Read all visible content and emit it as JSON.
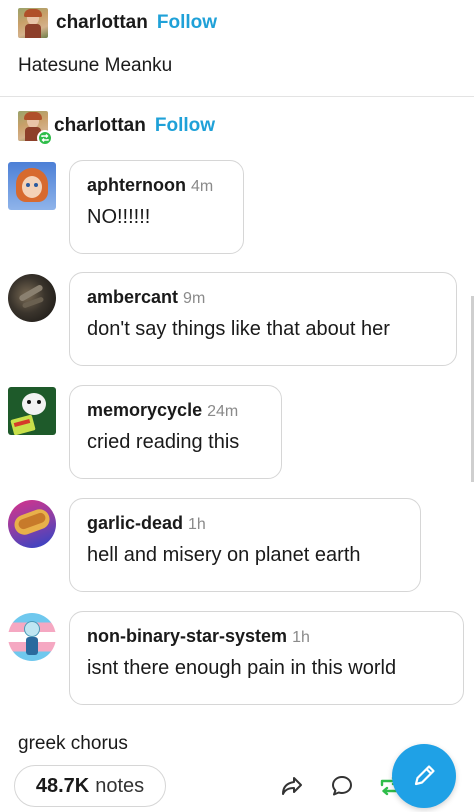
{
  "post": {
    "author": "charlottan",
    "follow_label": "Follow",
    "text": "Hatesune Meanku"
  },
  "reblog": {
    "author": "charlottan",
    "follow_label": "Follow"
  },
  "comments": [
    {
      "user": "aphternoon",
      "time": "4m",
      "text": "NO!!!!!!"
    },
    {
      "user": "ambercant",
      "time": "9m",
      "text": "don't say things like that about her"
    },
    {
      "user": "memorycycle",
      "time": "24m",
      "text": "cried reading this"
    },
    {
      "user": "garlic-dead",
      "time": "1h",
      "text": "hell and misery on planet earth"
    },
    {
      "user": "non-binary-star-system",
      "time": "1h",
      "text": "isnt there enough pain in this world"
    }
  ],
  "tags": "greek chorus",
  "footer": {
    "notes_count": "48.7K",
    "notes_label": "notes"
  },
  "icons": {
    "share": "share-arrow-icon",
    "reply": "speech-bubble-icon",
    "reblog": "reblog-icon",
    "compose": "pencil-icon"
  },
  "colors": {
    "accent": "#1fa1d8",
    "fab": "#1fa1e6",
    "reblog_green": "#2fbd4a"
  }
}
